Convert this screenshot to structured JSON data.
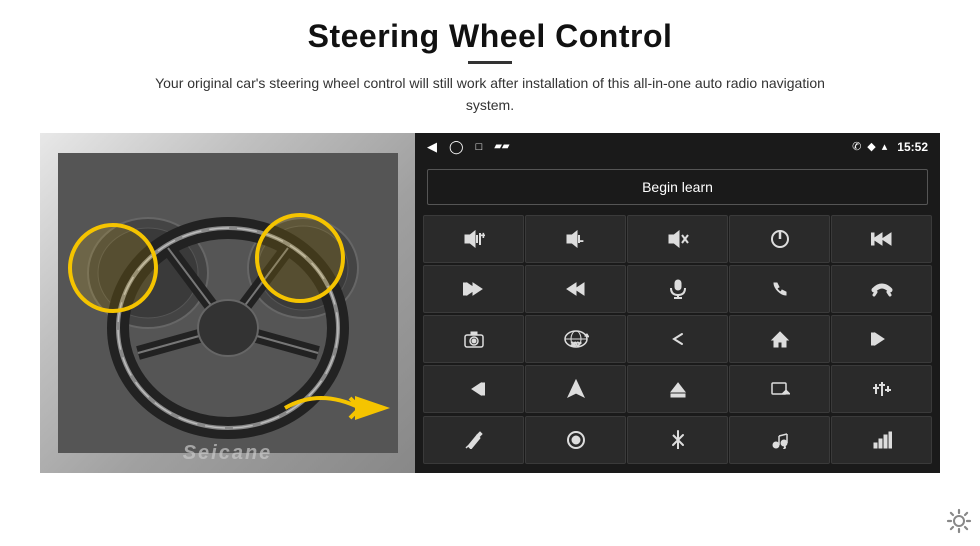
{
  "header": {
    "title": "Steering Wheel Control",
    "divider": true,
    "subtitle": "Your original car's steering wheel control will still work after installation of this all-in-one auto radio navigation system."
  },
  "statusBar": {
    "time": "15:52",
    "icons": [
      "back-arrow",
      "home",
      "square",
      "sim-icon",
      "phone-icon",
      "wifi-icon",
      "signal-icon"
    ]
  },
  "panel": {
    "beginLearnLabel": "Begin learn",
    "buttons": [
      {
        "icon": "vol-up",
        "symbol": "🔊+"
      },
      {
        "icon": "vol-down",
        "symbol": "🔊-"
      },
      {
        "icon": "mute",
        "symbol": "🔇"
      },
      {
        "icon": "power",
        "symbol": "⏻"
      },
      {
        "icon": "prev-track",
        "symbol": "⏮"
      },
      {
        "icon": "next",
        "symbol": "⏭"
      },
      {
        "icon": "seek-prev",
        "symbol": "⏮"
      },
      {
        "icon": "mic",
        "symbol": "🎤"
      },
      {
        "icon": "phone",
        "symbol": "📞"
      },
      {
        "icon": "hang-up",
        "symbol": "📵"
      },
      {
        "icon": "camera",
        "symbol": "📷"
      },
      {
        "icon": "360",
        "symbol": "360"
      },
      {
        "icon": "back",
        "symbol": "↩"
      },
      {
        "icon": "home2",
        "symbol": "🏠"
      },
      {
        "icon": "skip-back",
        "symbol": "⏮"
      },
      {
        "icon": "skip-fwd",
        "symbol": "⏭"
      },
      {
        "icon": "navigate",
        "symbol": "➤"
      },
      {
        "icon": "eject",
        "symbol": "⏏"
      },
      {
        "icon": "screenshot",
        "symbol": "📸"
      },
      {
        "icon": "equalizer",
        "symbol": "⚙"
      },
      {
        "icon": "pen",
        "symbol": "✏"
      },
      {
        "icon": "power2",
        "symbol": "⏻"
      },
      {
        "icon": "bluetooth",
        "symbol": "🔷"
      },
      {
        "icon": "music",
        "symbol": "🎵"
      },
      {
        "icon": "bars",
        "symbol": "📊"
      }
    ]
  },
  "watermark": "Seicane",
  "gear_icon": "⚙"
}
